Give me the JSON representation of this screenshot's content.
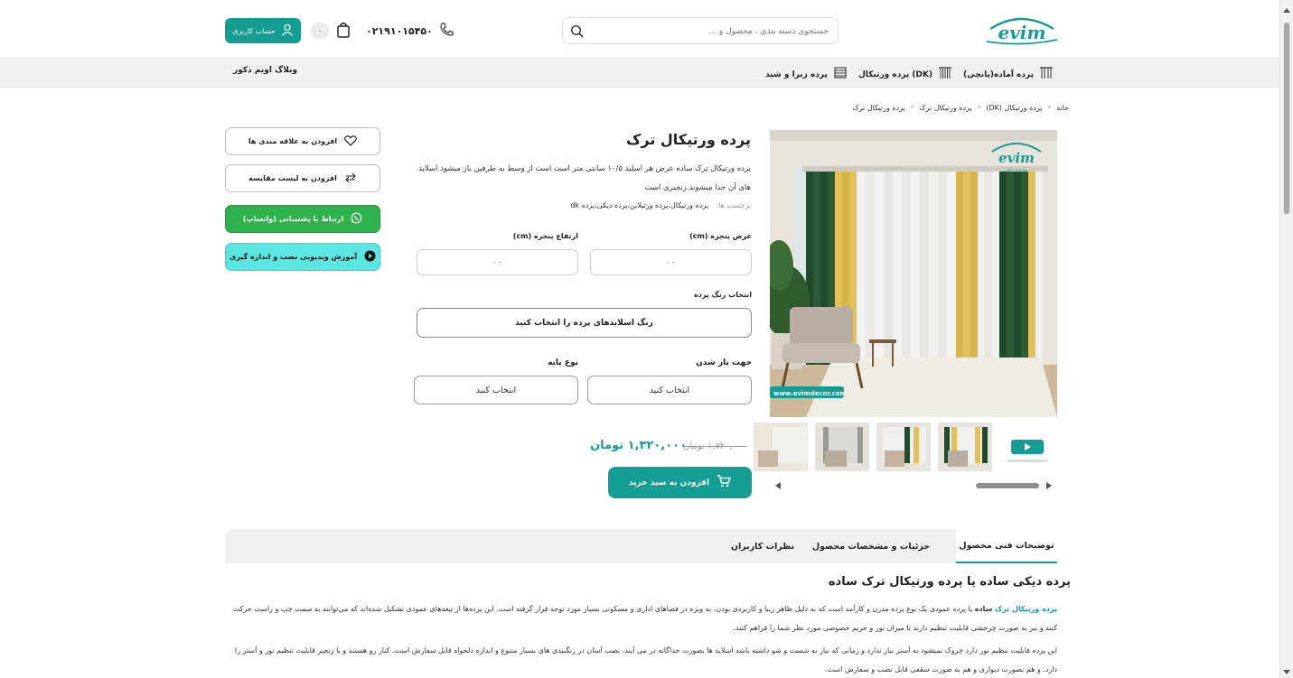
{
  "header": {
    "logo_text": "evim",
    "search_placeholder": "جستجوی دسته بندی ، محصول و ...",
    "phone": "۰۲۱۹۱۰۱۵۴۵۰",
    "cart_count": "۰",
    "account_label": "حساب کاربری"
  },
  "nav": {
    "items": [
      {
        "label": "پرده آماده(پانچی)"
      },
      {
        "label": "پرده ورتیکال (DK)"
      },
      {
        "label": "پرده زبرا و شید"
      },
      {
        "label": "وبلاگ اویم دکور"
      }
    ]
  },
  "breadcrumb": [
    "خانه",
    "پرده ورتیکال (DK)",
    "پرده ورتیکال ترک",
    "پرده ورتیکال ترک"
  ],
  "gallery": {
    "watermark": "www.evimdecor.com",
    "logo_sub": "پرده و دکور"
  },
  "product": {
    "title": "پرده ورتیکال ترک",
    "description": "پرده ورتیکال ترک ساده عرض هر اسلید ۱۰/۵ سانتی متر است است از وسط به طرفین باز میشود اسلاید های آن جدا میشوند.زنجیری است",
    "tags_label": "برچسب ها:",
    "tags": "پرده ورتیکال،پرده ورتیلاین،پرده دیکی،پرده dk",
    "width_label": "عرض پنجره (cm)",
    "height_label": "ارتفاع پنجره (cm)",
    "width_placeholder": "- -",
    "height_placeholder": "- -",
    "color_label": "انتخاب رنگ پرده",
    "color_button": "رنگ اسلایدهای پرده را انتخاب کنید",
    "open_dir_label": "جهت باز شدن",
    "base_type_label": "نوع پایه",
    "open_dir_value": "انتخاب کنید",
    "base_type_value": "انتخاب کنید",
    "old_price": "۱,۷۲۰,۰۰۰ تومان",
    "new_price": "۱,۳۲۰,۰۰۰ تومان",
    "add_to_cart": "افزودن به سبد خرید"
  },
  "side_actions": {
    "wishlist": "افزودن به علاقه مندی ها",
    "compare": "افزودن به لیست مقایسه",
    "whatsapp": "ارتباط با پشتیبانی (واتساپ)",
    "video": "آموزش ویدیویی نصب و اندازه گیری"
  },
  "tabs": [
    {
      "label": "توضیحات فنی محصول",
      "active": true
    },
    {
      "label": "جزئیات و مشخصات محصول",
      "active": false
    },
    {
      "label": "نظرات کاربران",
      "active": false
    }
  ],
  "content": {
    "section_title": "پرده دیکی ساده یا پرده ورتیکال ترک ساده",
    "p1_highlight": "پرده ورتیکال ترک",
    "p1_bold": "ساده",
    "p1_text": "یا پرده عمودی یک نوع پرده مدرن و کارآمد است که به دلیل ظاهر زیبا و کاربردی بودن، به ویژه در فضاهای اداری و مسکونی بسیار مورد توجه قرار گرفته است. این پرده‌ها از تیغه‌های عمودی تشکیل شده‌اند که می‌توانند به سمت چپ و راست حرکت کنند و نیز به صورت چرخشی قابلیت تنظیم دارند تا میزان نور و حریم خصوصی مورد نظر شما را فراهم کنند.",
    "p2_text": "این پرده قابلیت تنظیم نور دارد چروک نمیشود به آستر نیاز ندارد و زمانی که نیاز به شست و شو داشته باشد اسلاید ها بصورت جداگانه در می آیند. نصب آسان در رنگبندی های بسیار متنوع و اندازه دلخواه قابل سفارش است. کنار رو هستند و با زنجیر قابلیت تنظیم نور و آستر را دارد. و هم بصورت دیواری و هم به صورت سقفی قابل نصب و سفارش است."
  },
  "colors": {
    "brand": "#149d93",
    "whatsapp": "#2eb24b",
    "video": "#5ae7e2"
  }
}
